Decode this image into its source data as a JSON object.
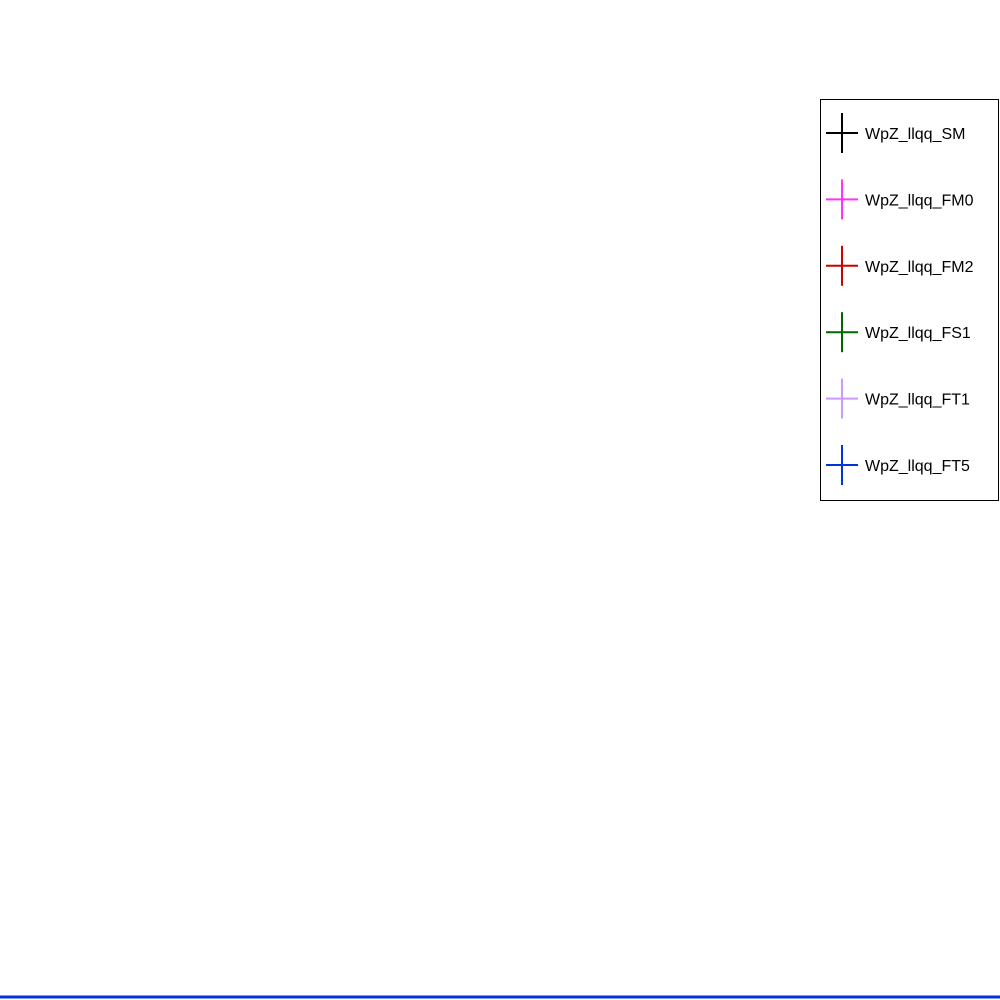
{
  "chart_data": {
    "type": "line",
    "title": "",
    "xlabel": "",
    "ylabel": "",
    "grid": false,
    "legend_position": "top-right",
    "series": [
      {
        "name": "WpZ_llqq_SM",
        "color": "#000000",
        "values": []
      },
      {
        "name": "WpZ_llqq_FM0",
        "color": "#ff33ff",
        "values": []
      },
      {
        "name": "WpZ_llqq_FM2",
        "color": "#cc0000",
        "values": []
      },
      {
        "name": "WpZ_llqq_FS1",
        "color": "#006600",
        "values": []
      },
      {
        "name": "WpZ_llqq_FT1",
        "color": "#cc99ff",
        "values": []
      },
      {
        "name": "WpZ_llqq_FT5",
        "color": "#0033dd",
        "values": []
      }
    ],
    "bottom_line_color": "#0033dd"
  }
}
